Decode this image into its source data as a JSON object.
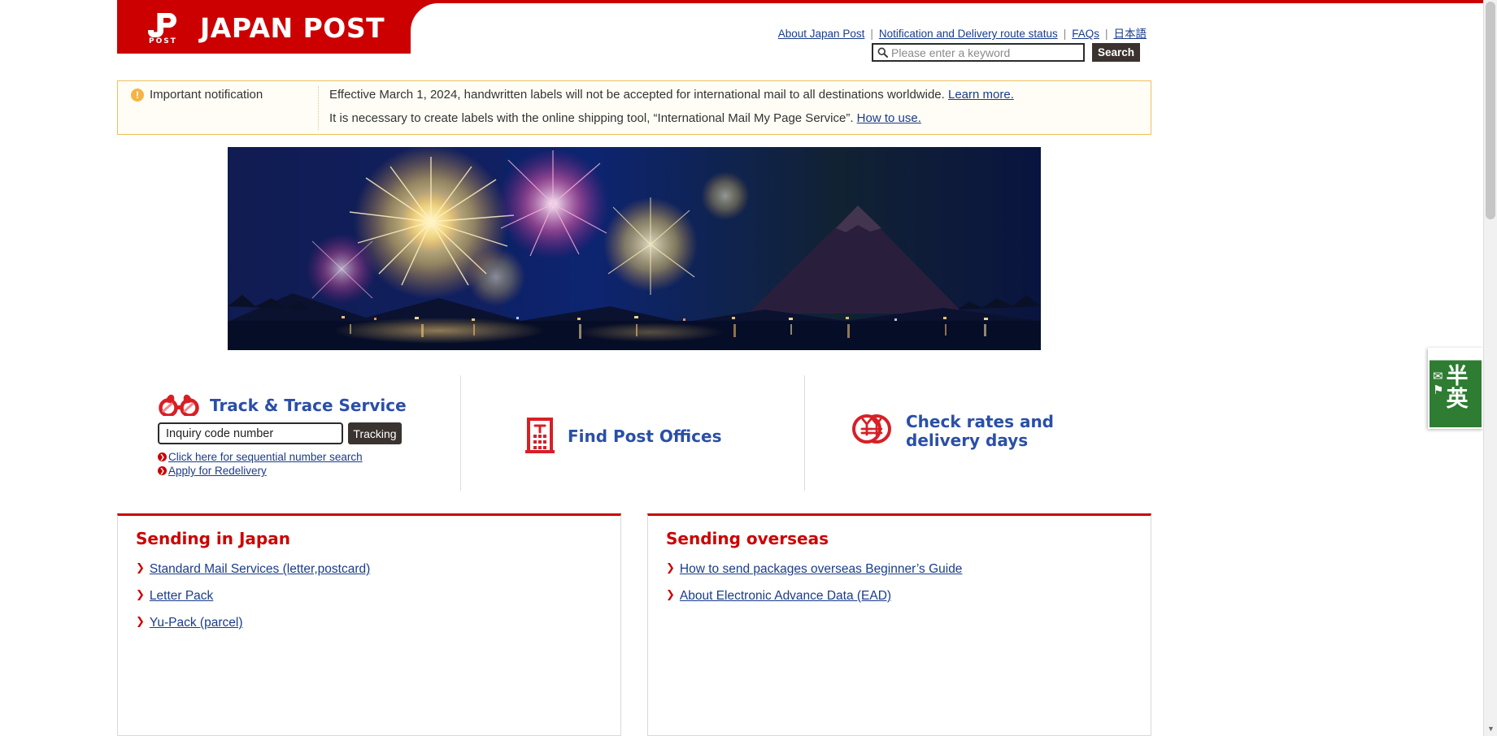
{
  "header": {
    "logo_text": "JAPAN POST",
    "logo_icon": "japan-post-logo-icon",
    "top_links": [
      {
        "label": "About Japan Post"
      },
      {
        "label": "Notification and Delivery route status"
      },
      {
        "label": "FAQs"
      },
      {
        "label": "日本語"
      }
    ],
    "separator": "|"
  },
  "search": {
    "placeholder": "Please enter a keyword",
    "value": "",
    "icon": "search-icon",
    "button_label": "Search"
  },
  "notification": {
    "icon": "warning-icon",
    "icon_glyph": "!",
    "label": "Important notification",
    "line1_text": "Effective March 1, 2024, handwritten labels will not be accepted for international mail to all destinations worldwide.",
    "line1_link": "Learn more.",
    "line2_text": "It is necessary to create labels with the online shipping tool, “International Mail My Page Service”.",
    "line2_link": "How to use."
  },
  "hero": {
    "alt": "Fireworks over lake with Mount Fuji at night"
  },
  "services": {
    "track": {
      "icon": "binoculars-icon",
      "title": "Track & Trace Service",
      "input_value": "Inquiry code number",
      "input_placeholder": "Inquiry code number",
      "button_label": "Tracking",
      "links": [
        {
          "label": "Click here for sequential number search"
        },
        {
          "label": "Apply for Redelivery"
        }
      ]
    },
    "find": {
      "icon": "post-office-building-icon",
      "title": "Find Post Offices"
    },
    "rates": {
      "icon": "yen-coins-icon",
      "title_line1": "Check rates and",
      "title_line2": "delivery days"
    }
  },
  "panels": [
    {
      "title": "Sending in Japan",
      "links": [
        {
          "label": "Standard Mail Services (letter,postcard)"
        },
        {
          "label": "Letter Pack"
        },
        {
          "label": "Yu-Pack (parcel)"
        }
      ]
    },
    {
      "title": "Sending overseas",
      "links": [
        {
          "label": "How to send packages overseas Beginner’s Guide"
        },
        {
          "label": "About Electronic Advance Data (EAD)"
        }
      ]
    }
  ],
  "side_badge": {
    "line1": "半",
    "line2": "英",
    "icon": "mailbox-icon"
  },
  "scrollbar": {
    "up_arrow": "▲",
    "down_arrow": "▼"
  },
  "colors": {
    "brand_red": "#cc0000",
    "link_blue": "#1a3c8c",
    "title_blue": "#2a4fa8",
    "notif_border": "#f0bf5a",
    "notif_bg": "#fffdf6",
    "dark_button": "#3a3330"
  }
}
